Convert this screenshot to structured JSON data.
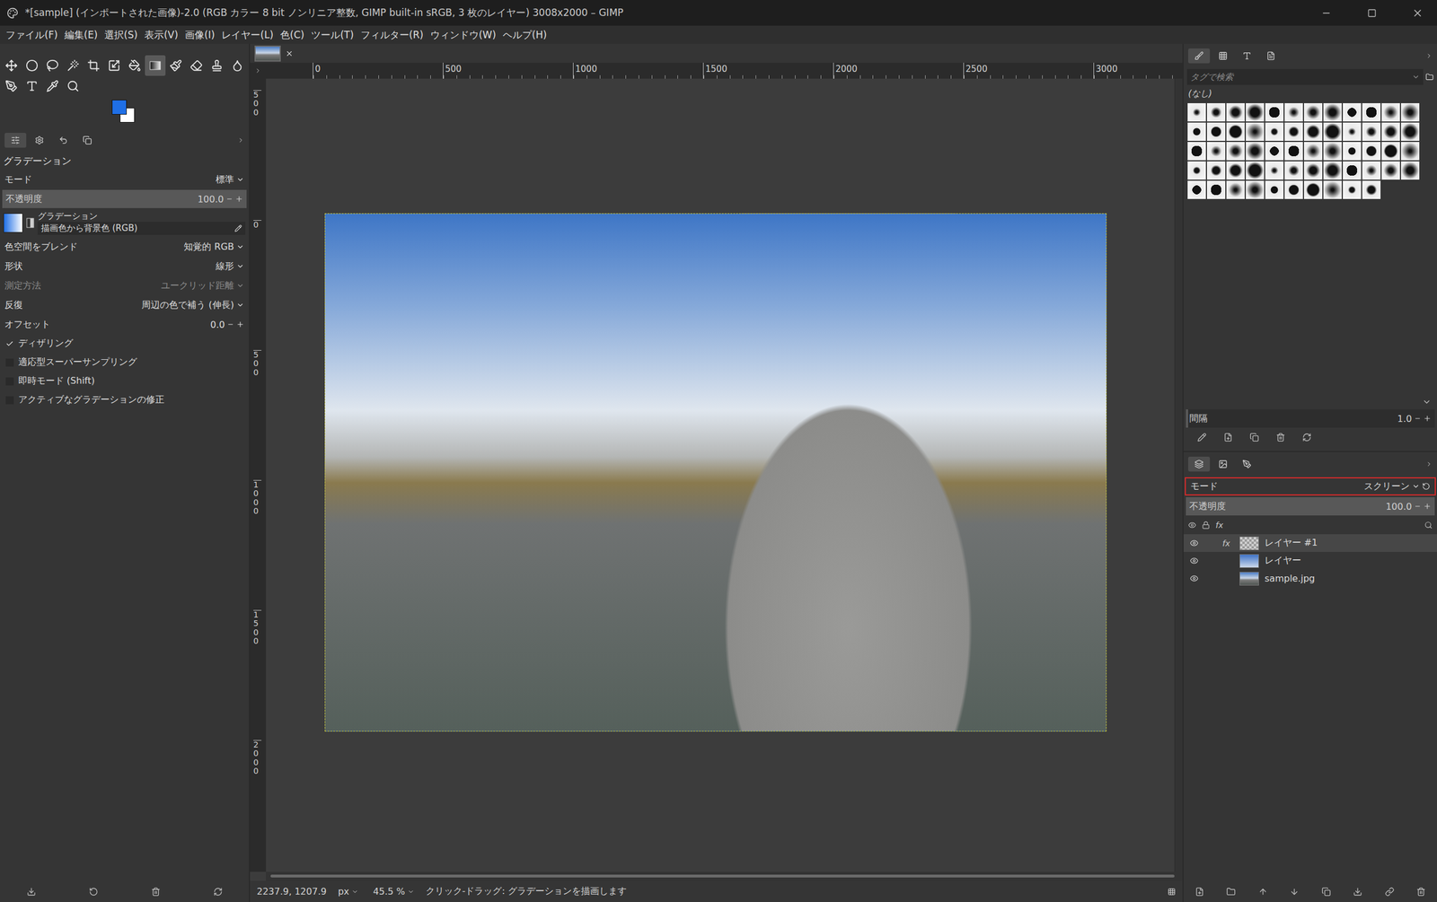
{
  "window": {
    "title": "*[sample] (インポートされた画像)-2.0 (RGB カラー 8 bit ノンリニア整数, GIMP built-in sRGB, 3 枚のレイヤー) 3008x2000 – GIMP"
  },
  "menu": [
    "ファイル(F)",
    "編集(E)",
    "選択(S)",
    "表示(V)",
    "画像(I)",
    "レイヤー(L)",
    "色(C)",
    "ツール(T)",
    "フィルター(R)",
    "ウィンドウ(W)",
    "ヘルプ(H)"
  ],
  "tools": [
    {
      "kind": "move",
      "selected": false
    },
    {
      "kind": "ellipse-select",
      "selected": false
    },
    {
      "kind": "free-select",
      "selected": false
    },
    {
      "kind": "fuzzy-select",
      "selected": false
    },
    {
      "kind": "crop",
      "selected": false
    },
    {
      "kind": "transform",
      "selected": false
    },
    {
      "kind": "bucket",
      "selected": false
    },
    {
      "kind": "gradient",
      "selected": true
    },
    {
      "kind": "paintbrush",
      "selected": false
    },
    {
      "kind": "eraser",
      "selected": false
    },
    {
      "kind": "clone",
      "selected": false
    },
    {
      "kind": "smudge",
      "selected": false
    },
    {
      "kind": "paths",
      "selected": false
    },
    {
      "kind": "text",
      "selected": false
    },
    {
      "kind": "color-picker",
      "selected": false
    },
    {
      "kind": "zoom",
      "selected": false
    }
  ],
  "colors": {
    "foreground": "#1f6fe6",
    "background": "#ffffff"
  },
  "tool_options": {
    "title": "グラデーション",
    "rows": [
      {
        "kind": "select",
        "label": "モード",
        "value": "標準",
        "disabled": false
      },
      {
        "kind": "slider",
        "label": "不透明度",
        "value": "100.0",
        "level": 1,
        "disabled": false
      },
      {
        "kind": "gradient",
        "label": "グラデーション",
        "value": "描画色から背景色 (RGB)",
        "disabled": false
      },
      {
        "kind": "select",
        "label": "色空間をブレンド",
        "value": "知覚的 RGB",
        "disabled": false
      },
      {
        "kind": "select",
        "label": "形状",
        "value": "線形",
        "disabled": false
      },
      {
        "kind": "select",
        "label": "測定方法",
        "value": "ユークリッド距離",
        "disabled": true
      },
      {
        "kind": "select",
        "label": "反復",
        "value": "周辺の色で補う (伸長)",
        "disabled": false
      },
      {
        "kind": "spin",
        "label": "オフセット",
        "value": "0.0",
        "disabled": false
      }
    ],
    "checkboxes": [
      {
        "label": "ディザリング",
        "checked": true
      },
      {
        "label": "適応型スーパーサンプリング",
        "checked": false
      },
      {
        "label": "即時モード (Shift)",
        "checked": false
      },
      {
        "label": "アクティブなグラデーションの修正",
        "checked": false
      }
    ]
  },
  "rulers": {
    "horizontal": [
      "0",
      "500",
      "1000",
      "1500",
      "2000",
      "2500",
      "3000"
    ],
    "vertical": [
      "500",
      "0",
      "500",
      "1000",
      "1500",
      "2000"
    ]
  },
  "brushes": {
    "search_placeholder": "タグで検索",
    "tag": "(なし)",
    "spacing_label": "間隔",
    "spacing": "1.0",
    "spacing_level": 0.01
  },
  "layers": {
    "mode_label": "モード",
    "mode": "スクリーン",
    "highlighted": true,
    "opacity_label": "不透明度",
    "opacity": "100.0",
    "opacity_level": 1,
    "fx": "fx",
    "items": [
      {
        "name": "レイヤー #1",
        "selected": true,
        "visible": true,
        "fx": true,
        "kind": "checker"
      },
      {
        "name": "レイヤー",
        "selected": false,
        "visible": true,
        "fx": false,
        "kind": "sky"
      },
      {
        "name": "sample.jpg",
        "selected": false,
        "visible": true,
        "fx": false,
        "kind": "photo"
      }
    ]
  },
  "status_bar": {
    "coords": "2237.9, 1207.9",
    "unit": "px",
    "zoom": "45.5 %",
    "message": "クリック-ドラッグ: グラデーションを描画します"
  }
}
